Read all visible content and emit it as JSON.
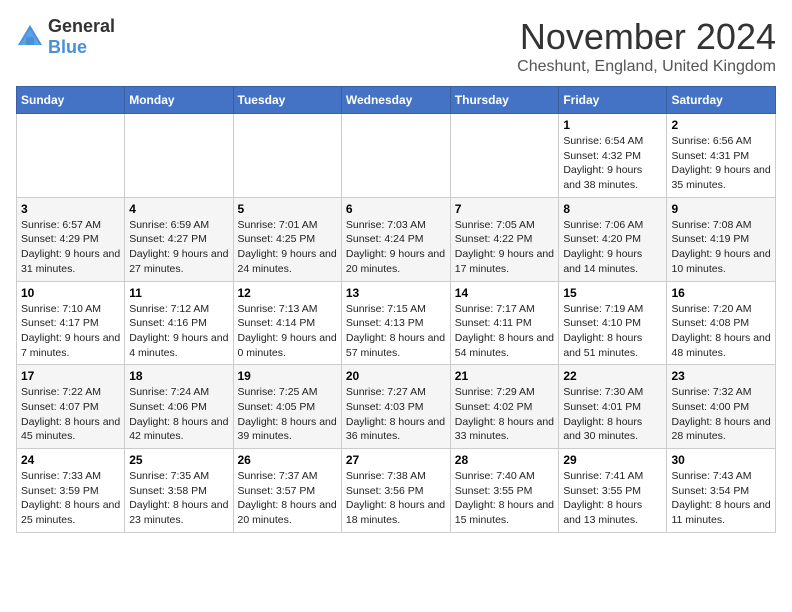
{
  "logo": {
    "text_general": "General",
    "text_blue": "Blue"
  },
  "header": {
    "month_year": "November 2024",
    "location": "Cheshunt, England, United Kingdom"
  },
  "weekdays": [
    "Sunday",
    "Monday",
    "Tuesday",
    "Wednesday",
    "Thursday",
    "Friday",
    "Saturday"
  ],
  "weeks": [
    [
      {
        "day": "",
        "info": ""
      },
      {
        "day": "",
        "info": ""
      },
      {
        "day": "",
        "info": ""
      },
      {
        "day": "",
        "info": ""
      },
      {
        "day": "",
        "info": ""
      },
      {
        "day": "1",
        "info": "Sunrise: 6:54 AM\nSunset: 4:32 PM\nDaylight: 9 hours and 38 minutes."
      },
      {
        "day": "2",
        "info": "Sunrise: 6:56 AM\nSunset: 4:31 PM\nDaylight: 9 hours and 35 minutes."
      }
    ],
    [
      {
        "day": "3",
        "info": "Sunrise: 6:57 AM\nSunset: 4:29 PM\nDaylight: 9 hours and 31 minutes."
      },
      {
        "day": "4",
        "info": "Sunrise: 6:59 AM\nSunset: 4:27 PM\nDaylight: 9 hours and 27 minutes."
      },
      {
        "day": "5",
        "info": "Sunrise: 7:01 AM\nSunset: 4:25 PM\nDaylight: 9 hours and 24 minutes."
      },
      {
        "day": "6",
        "info": "Sunrise: 7:03 AM\nSunset: 4:24 PM\nDaylight: 9 hours and 20 minutes."
      },
      {
        "day": "7",
        "info": "Sunrise: 7:05 AM\nSunset: 4:22 PM\nDaylight: 9 hours and 17 minutes."
      },
      {
        "day": "8",
        "info": "Sunrise: 7:06 AM\nSunset: 4:20 PM\nDaylight: 9 hours and 14 minutes."
      },
      {
        "day": "9",
        "info": "Sunrise: 7:08 AM\nSunset: 4:19 PM\nDaylight: 9 hours and 10 minutes."
      }
    ],
    [
      {
        "day": "10",
        "info": "Sunrise: 7:10 AM\nSunset: 4:17 PM\nDaylight: 9 hours and 7 minutes."
      },
      {
        "day": "11",
        "info": "Sunrise: 7:12 AM\nSunset: 4:16 PM\nDaylight: 9 hours and 4 minutes."
      },
      {
        "day": "12",
        "info": "Sunrise: 7:13 AM\nSunset: 4:14 PM\nDaylight: 9 hours and 0 minutes."
      },
      {
        "day": "13",
        "info": "Sunrise: 7:15 AM\nSunset: 4:13 PM\nDaylight: 8 hours and 57 minutes."
      },
      {
        "day": "14",
        "info": "Sunrise: 7:17 AM\nSunset: 4:11 PM\nDaylight: 8 hours and 54 minutes."
      },
      {
        "day": "15",
        "info": "Sunrise: 7:19 AM\nSunset: 4:10 PM\nDaylight: 8 hours and 51 minutes."
      },
      {
        "day": "16",
        "info": "Sunrise: 7:20 AM\nSunset: 4:08 PM\nDaylight: 8 hours and 48 minutes."
      }
    ],
    [
      {
        "day": "17",
        "info": "Sunrise: 7:22 AM\nSunset: 4:07 PM\nDaylight: 8 hours and 45 minutes."
      },
      {
        "day": "18",
        "info": "Sunrise: 7:24 AM\nSunset: 4:06 PM\nDaylight: 8 hours and 42 minutes."
      },
      {
        "day": "19",
        "info": "Sunrise: 7:25 AM\nSunset: 4:05 PM\nDaylight: 8 hours and 39 minutes."
      },
      {
        "day": "20",
        "info": "Sunrise: 7:27 AM\nSunset: 4:03 PM\nDaylight: 8 hours and 36 minutes."
      },
      {
        "day": "21",
        "info": "Sunrise: 7:29 AM\nSunset: 4:02 PM\nDaylight: 8 hours and 33 minutes."
      },
      {
        "day": "22",
        "info": "Sunrise: 7:30 AM\nSunset: 4:01 PM\nDaylight: 8 hours and 30 minutes."
      },
      {
        "day": "23",
        "info": "Sunrise: 7:32 AM\nSunset: 4:00 PM\nDaylight: 8 hours and 28 minutes."
      }
    ],
    [
      {
        "day": "24",
        "info": "Sunrise: 7:33 AM\nSunset: 3:59 PM\nDaylight: 8 hours and 25 minutes."
      },
      {
        "day": "25",
        "info": "Sunrise: 7:35 AM\nSunset: 3:58 PM\nDaylight: 8 hours and 23 minutes."
      },
      {
        "day": "26",
        "info": "Sunrise: 7:37 AM\nSunset: 3:57 PM\nDaylight: 8 hours and 20 minutes."
      },
      {
        "day": "27",
        "info": "Sunrise: 7:38 AM\nSunset: 3:56 PM\nDaylight: 8 hours and 18 minutes."
      },
      {
        "day": "28",
        "info": "Sunrise: 7:40 AM\nSunset: 3:55 PM\nDaylight: 8 hours and 15 minutes."
      },
      {
        "day": "29",
        "info": "Sunrise: 7:41 AM\nSunset: 3:55 PM\nDaylight: 8 hours and 13 minutes."
      },
      {
        "day": "30",
        "info": "Sunrise: 7:43 AM\nSunset: 3:54 PM\nDaylight: 8 hours and 11 minutes."
      }
    ]
  ]
}
